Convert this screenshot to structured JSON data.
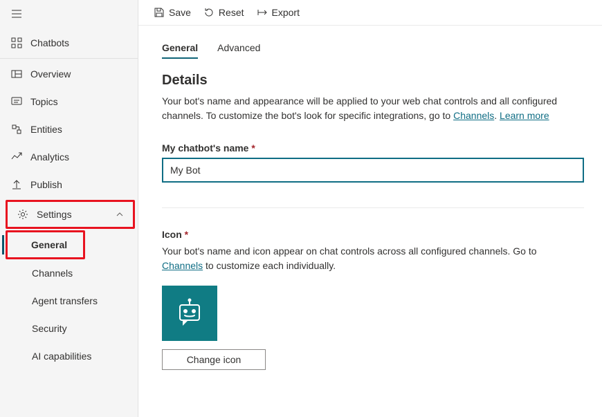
{
  "sidebar": {
    "chatbots": "Chatbots",
    "items": [
      {
        "label": "Overview"
      },
      {
        "label": "Topics"
      },
      {
        "label": "Entities"
      },
      {
        "label": "Analytics"
      },
      {
        "label": "Publish"
      }
    ],
    "settings_label": "Settings",
    "settings_subitems": [
      {
        "label": "General"
      },
      {
        "label": "Channels"
      },
      {
        "label": "Agent transfers"
      },
      {
        "label": "Security"
      },
      {
        "label": "AI capabilities"
      }
    ]
  },
  "toolbar": {
    "save": "Save",
    "reset": "Reset",
    "export": "Export"
  },
  "tabs": {
    "general": "General",
    "advanced": "Advanced"
  },
  "details": {
    "title": "Details",
    "desc_before": "Your bot's name and appearance will be applied to your web chat controls and all configured channels. To customize the bot's look for specific integrations, go to ",
    "channels_link": "Channels",
    "sep": ". ",
    "learn_more": "Learn more",
    "name_label": "My chatbot's name",
    "name_value": "My Bot"
  },
  "icon_section": {
    "label": "Icon",
    "desc_before": "Your bot's name and icon appear on chat controls across all configured channels. Go to ",
    "channels_link": "Channels",
    "desc_after": " to customize each individually.",
    "change_btn": "Change icon"
  }
}
